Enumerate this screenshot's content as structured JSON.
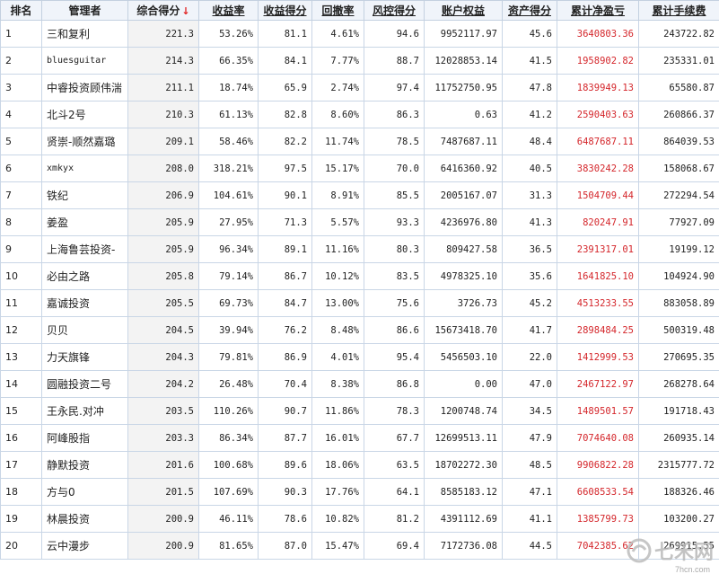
{
  "headers": {
    "rank": "排名",
    "manager": "管理者",
    "score": "综合得分",
    "sort_arrow": "↓",
    "return_rate": "收益率",
    "return_score": "收益得分",
    "drawdown": "回撤率",
    "risk_score": "风控得分",
    "equity": "账户权益",
    "asset_score": "资产得分",
    "net_profit": "累计净盈亏",
    "fees": "累计手续费"
  },
  "rows": [
    {
      "rank": "1",
      "manager": "三和复利",
      "score": "221.3",
      "return_rate": "53.26%",
      "return_score": "81.1",
      "drawdown": "4.61%",
      "risk_score": "94.6",
      "equity": "9952117.97",
      "asset_score": "45.6",
      "net_profit": "3640803.36",
      "fees": "243722.82"
    },
    {
      "rank": "2",
      "manager": "bluesguitar",
      "score": "214.3",
      "return_rate": "66.35%",
      "return_score": "84.1",
      "drawdown": "7.77%",
      "risk_score": "88.7",
      "equity": "12028853.14",
      "asset_score": "41.5",
      "net_profit": "1958902.82",
      "fees": "235331.01"
    },
    {
      "rank": "3",
      "manager": "中睿投资顾伟湍",
      "score": "211.1",
      "return_rate": "18.74%",
      "return_score": "65.9",
      "drawdown": "2.74%",
      "risk_score": "97.4",
      "equity": "11752750.95",
      "asset_score": "47.8",
      "net_profit": "1839949.13",
      "fees": "65580.87"
    },
    {
      "rank": "4",
      "manager": "北斗2号",
      "score": "210.3",
      "return_rate": "61.13%",
      "return_score": "82.8",
      "drawdown": "8.60%",
      "risk_score": "86.3",
      "equity": "0.63",
      "asset_score": "41.2",
      "net_profit": "2590403.63",
      "fees": "260866.37"
    },
    {
      "rank": "5",
      "manager": "贤崇-顺然嘉璐",
      "score": "209.1",
      "return_rate": "58.46%",
      "return_score": "82.2",
      "drawdown": "11.74%",
      "risk_score": "78.5",
      "equity": "7487687.11",
      "asset_score": "48.4",
      "net_profit": "6487687.11",
      "fees": "864039.53"
    },
    {
      "rank": "6",
      "manager": "xmkyx",
      "score": "208.0",
      "return_rate": "318.21%",
      "return_score": "97.5",
      "drawdown": "15.17%",
      "risk_score": "70.0",
      "equity": "6416360.92",
      "asset_score": "40.5",
      "net_profit": "3830242.28",
      "fees": "158068.67"
    },
    {
      "rank": "7",
      "manager": "铁纪",
      "score": "206.9",
      "return_rate": "104.61%",
      "return_score": "90.1",
      "drawdown": "8.91%",
      "risk_score": "85.5",
      "equity": "2005167.07",
      "asset_score": "31.3",
      "net_profit": "1504709.44",
      "fees": "272294.54"
    },
    {
      "rank": "8",
      "manager": "姜盈",
      "score": "205.9",
      "return_rate": "27.95%",
      "return_score": "71.3",
      "drawdown": "5.57%",
      "risk_score": "93.3",
      "equity": "4236976.80",
      "asset_score": "41.3",
      "net_profit": "820247.91",
      "fees": "77927.09"
    },
    {
      "rank": "9",
      "manager": "上海鲁芸投资-",
      "score": "205.9",
      "return_rate": "96.34%",
      "return_score": "89.1",
      "drawdown": "11.16%",
      "risk_score": "80.3",
      "equity": "809427.58",
      "asset_score": "36.5",
      "net_profit": "2391317.01",
      "fees": "19199.12"
    },
    {
      "rank": "10",
      "manager": "必由之路",
      "score": "205.8",
      "return_rate": "79.14%",
      "return_score": "86.7",
      "drawdown": "10.12%",
      "risk_score": "83.5",
      "equity": "4978325.10",
      "asset_score": "35.6",
      "net_profit": "1641825.10",
      "fees": "104924.90"
    },
    {
      "rank": "11",
      "manager": "嘉诚投资",
      "score": "205.5",
      "return_rate": "69.73%",
      "return_score": "84.7",
      "drawdown": "13.00%",
      "risk_score": "75.6",
      "equity": "3726.73",
      "asset_score": "45.2",
      "net_profit": "4513233.55",
      "fees": "883058.89"
    },
    {
      "rank": "12",
      "manager": "贝贝",
      "score": "204.5",
      "return_rate": "39.94%",
      "return_score": "76.2",
      "drawdown": "8.48%",
      "risk_score": "86.6",
      "equity": "15673418.70",
      "asset_score": "41.7",
      "net_profit": "2898484.25",
      "fees": "500319.48"
    },
    {
      "rank": "13",
      "manager": "力天旗锋",
      "score": "204.3",
      "return_rate": "79.81%",
      "return_score": "86.9",
      "drawdown": "4.01%",
      "risk_score": "95.4",
      "equity": "5456503.10",
      "asset_score": "22.0",
      "net_profit": "1412999.53",
      "fees": "270695.35"
    },
    {
      "rank": "14",
      "manager": "圆融投资二号",
      "score": "204.2",
      "return_rate": "26.48%",
      "return_score": "70.4",
      "drawdown": "8.38%",
      "risk_score": "86.8",
      "equity": "0.00",
      "asset_score": "47.0",
      "net_profit": "2467122.97",
      "fees": "268278.64"
    },
    {
      "rank": "15",
      "manager": "王永民.对冲",
      "score": "203.5",
      "return_rate": "110.26%",
      "return_score": "90.7",
      "drawdown": "11.86%",
      "risk_score": "78.3",
      "equity": "1200748.74",
      "asset_score": "34.5",
      "net_profit": "1489501.57",
      "fees": "191718.43"
    },
    {
      "rank": "16",
      "manager": "阿峰股指",
      "score": "203.3",
      "return_rate": "86.34%",
      "return_score": "87.7",
      "drawdown": "16.01%",
      "risk_score": "67.7",
      "equity": "12699513.11",
      "asset_score": "47.9",
      "net_profit": "7074640.08",
      "fees": "260935.14"
    },
    {
      "rank": "17",
      "manager": "静默投资",
      "score": "201.6",
      "return_rate": "100.68%",
      "return_score": "89.6",
      "drawdown": "18.06%",
      "risk_score": "63.5",
      "equity": "18702272.30",
      "asset_score": "48.5",
      "net_profit": "9906822.28",
      "fees": "2315777.72"
    },
    {
      "rank": "18",
      "manager": "方与0",
      "score": "201.5",
      "return_rate": "107.69%",
      "return_score": "90.3",
      "drawdown": "17.76%",
      "risk_score": "64.1",
      "equity": "8585183.12",
      "asset_score": "47.1",
      "net_profit": "6608533.54",
      "fees": "188326.46"
    },
    {
      "rank": "19",
      "manager": "林晨投资",
      "score": "200.9",
      "return_rate": "46.11%",
      "return_score": "78.6",
      "drawdown": "10.82%",
      "risk_score": "81.2",
      "equity": "4391112.69",
      "asset_score": "41.1",
      "net_profit": "1385799.73",
      "fees": "103200.27"
    },
    {
      "rank": "20",
      "manager": "云中漫步",
      "score": "200.9",
      "return_rate": "81.65%",
      "return_score": "87.0",
      "drawdown": "15.47%",
      "risk_score": "69.4",
      "equity": "7172736.08",
      "asset_score": "44.5",
      "net_profit": "7042385.62",
      "fees": "269915.55"
    }
  ],
  "watermark": {
    "text": "七禾网",
    "url": "7hcn.com"
  },
  "colors": {
    "profit": "#d4262b",
    "header_link": "#1245c7",
    "border": "#c9d6e6"
  }
}
